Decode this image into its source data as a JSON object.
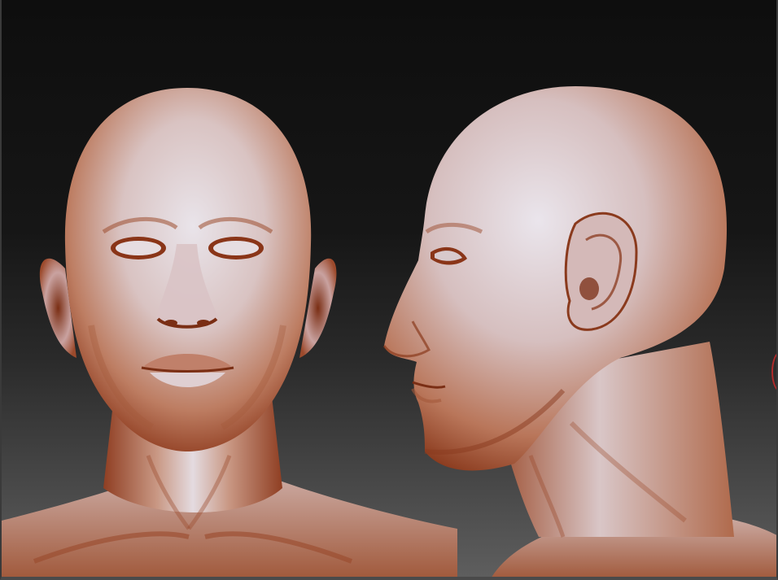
{
  "viewport": {
    "background_top": "#0e0e0e",
    "background_bottom": "#5e5e5e"
  },
  "model": {
    "material_color": "#c98a6e",
    "highlight_color": "#e9e4ea",
    "cavity_color": "#7a2e14",
    "views": [
      "front",
      "side"
    ]
  },
  "edge_marker_color": "#b02a2a"
}
